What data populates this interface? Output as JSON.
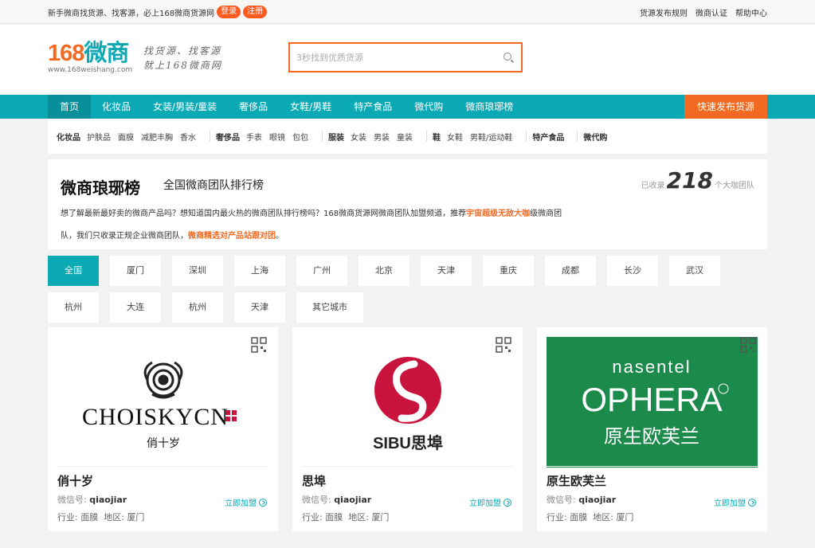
{
  "topbar": {
    "welcome": "新手微商找货源、找客源，必上168微商货源网",
    "login_label": "登录",
    "register_label": "注册",
    "links": [
      "货源发布规则",
      "微商认证",
      "帮助中心"
    ]
  },
  "header": {
    "logo_num": "168",
    "logo_cn": "微商",
    "logo_url": "www.168weishang.com",
    "slogan_line1": "找货源、找客源",
    "slogan_line2": "就上168微商网",
    "search_placeholder": "3秒找到优质货源"
  },
  "nav": {
    "items": [
      "首页",
      "化妆品",
      "女装/男装/童装",
      "奢侈品",
      "女鞋/男鞋",
      "特产食品",
      "微代购",
      "微商琅琊榜"
    ],
    "active_index": 0,
    "publish_label": "快速发布货源"
  },
  "subcat": [
    {
      "head": "化妆品",
      "items": [
        "护肤品",
        "面膜",
        "减肥丰胸",
        "香水"
      ]
    },
    {
      "head": "奢侈品",
      "items": [
        "手表",
        "眼镜",
        "包包"
      ]
    },
    {
      "head": "服装",
      "items": [
        "女装",
        "男装",
        "童装"
      ]
    },
    {
      "head": "鞋",
      "items": [
        "女鞋",
        "男鞋/运动鞋"
      ]
    },
    {
      "head": "特产食品",
      "items": []
    },
    {
      "head": "微代购",
      "items": []
    }
  ],
  "intro": {
    "title": "微商琅琊榜",
    "subtitle": "全国微商团队排行榜",
    "count_prefix": "已收录",
    "count_value": "218",
    "count_suffix": "个大咖团队",
    "desc_part1": "想了解最新最好卖的微商产品吗？想知道国内最火热的微商团队排行榜吗？168微商货源网微商团队加盟频道，推荐",
    "desc_highlight1": "宇宙超级无敌大咖",
    "desc_part2": "级微商团队，我们只收录正规企业微商团队，",
    "desc_highlight2": "微商精选对产品站跟对团",
    "desc_part3": "。"
  },
  "cities": [
    "全国",
    "厦门",
    "深圳",
    "上海",
    "广州",
    "北京",
    "天津",
    "重庆",
    "成都",
    "长沙",
    "武汉",
    "杭州",
    "大连",
    "杭州",
    "天津",
    "其它城市"
  ],
  "cards": [
    {
      "name": "俏十岁",
      "wx_label": "微信号:",
      "wx": "qiaojiar",
      "industry_label": "行业:",
      "industry": "面膜",
      "area_label": "地区:",
      "area": "厦门",
      "join": "立即加盟",
      "brand_text": "CHOISKYCN",
      "brand_sub": "俏十岁"
    },
    {
      "name": "思埠",
      "wx_label": "微信号:",
      "wx": "qiaojiar",
      "industry_label": "行业:",
      "industry": "面膜",
      "area_label": "地区:",
      "area": "厦门",
      "join": "立即加盟",
      "brand_text": "SIBU思埠"
    },
    {
      "name": "原生欧芙兰",
      "wx_label": "微信号:",
      "wx": "qiaojiar",
      "industry_label": "行业:",
      "industry": "面膜",
      "area_label": "地区:",
      "area": "厦门",
      "join": "立即加盟",
      "brand_top": "nasentel",
      "brand_text": "OPHERA",
      "brand_sub": "原生欧芙兰"
    }
  ],
  "colors": {
    "teal": "#0aa9b4",
    "orange": "#f26a21",
    "crimson": "#c8143c",
    "green": "#1b8a4a"
  }
}
